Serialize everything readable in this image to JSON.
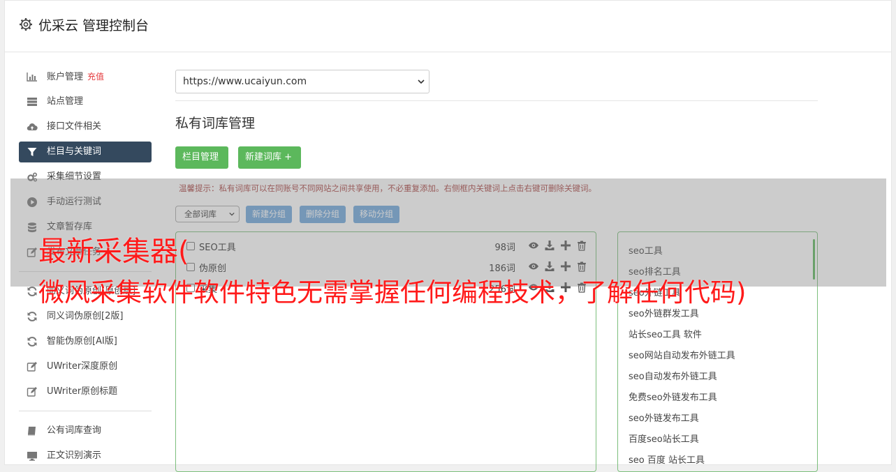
{
  "header": {
    "title": "优采云 管理控制台"
  },
  "sidebar": {
    "items": [
      {
        "label": "账户管理",
        "badge": "充值",
        "icon": "bar-chart-icon"
      },
      {
        "label": "站点管理",
        "icon": "server-icon"
      },
      {
        "label": "接口文件相关",
        "icon": "cloud-upload-icon"
      },
      {
        "label": "栏目与关键词",
        "icon": "filter-icon",
        "active": true
      },
      {
        "label": "采集细节设置",
        "icon": "gears-icon"
      },
      {
        "label": "手动运行测试",
        "icon": "play-circle-icon"
      },
      {
        "label": "文章暂存库",
        "icon": "database-icon"
      },
      {
        "label": "发布文章任务",
        "icon": "edit-icon"
      },
      {
        "label": "同义词伪原创[原创版]",
        "icon": "refresh-icon"
      },
      {
        "label": "同义词伪原创[2版]",
        "icon": "refresh-icon"
      },
      {
        "label": "智能伪原创[AI版]",
        "icon": "refresh-icon"
      },
      {
        "label": "UWriter深度原创",
        "icon": "edit-icon"
      },
      {
        "label": "UWriter原创标题",
        "icon": "edit-icon"
      },
      {
        "label": "公有词库查询",
        "icon": "book-icon"
      },
      {
        "label": "正文识别演示",
        "icon": "monitor-icon"
      }
    ]
  },
  "main": {
    "site_select": "https://www.ucaiyun.com",
    "page_title": "私有词库管理",
    "btn_column": "栏目管理",
    "btn_new_lib": "新建词库 +",
    "tip": "温馨提示：私有词库可以在同账号不同网站之间共享使用，不必重复添加。右侧框内关键词上点击右键可删除关键词。",
    "lib_select": "全部词库",
    "btn_new_group": "新建分组",
    "btn_del_group": "删除分组",
    "btn_move_group": "移动分组",
    "libraries": [
      {
        "name": "SEO工具",
        "count": "98词"
      },
      {
        "name": "伪原创",
        "count": "186词"
      },
      {
        "name": "采集",
        "count": "256词"
      }
    ],
    "keywords": [
      "seo工具",
      "seo排名工具",
      "seo外链工具",
      "seo外链群发工具",
      "站长seo工具 软件",
      "seo网站自动发布外链工具",
      "seo自动发布外链工具",
      "免费seo外链发布工具",
      "seo外链发布工具",
      "百度seo站长工具",
      "seo 百度 站长工具"
    ]
  },
  "overlay": {
    "line1": "最新采集器(",
    "line2": "微风采集软件软件特色无需掌握任何编程技术，了解任何代码)"
  },
  "colors": {
    "active_nav": "#34495e",
    "green": "#5cb85c",
    "blue": "#6fa7dd",
    "tip_red": "#a94442",
    "overlay_red": "#ff1a1a"
  }
}
